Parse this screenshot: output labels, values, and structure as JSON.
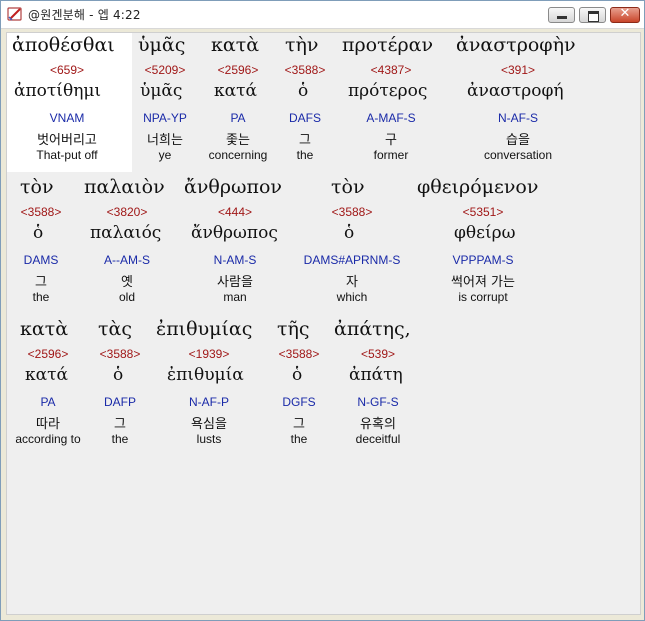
{
  "window": {
    "title": "@원겐분해 - 엡 4:22",
    "app_icon": "app-icon",
    "buttons": [
      "minimize",
      "maximize",
      "close"
    ],
    "close_glyph": "✕"
  },
  "lines": [
    {
      "words": [
        {
          "greek": "ἀποθέσθαι",
          "strong": "<659>",
          "lemma": "ἀποτίθημι",
          "parse": "VNAM",
          "korean": "벗어버리고",
          "english": "That-put off"
        },
        {
          "greek": "ὑμᾶς",
          "strong": "<5209>",
          "lemma": "ὑμᾶς",
          "parse": "NPA-YP",
          "korean": "너희는",
          "english": "ye"
        },
        {
          "greek": "κατὰ",
          "strong": "<2596>",
          "lemma": "κατά",
          "parse": "PA",
          "korean": "좇는",
          "english": "concerning"
        },
        {
          "greek": "τὴν",
          "strong": "<3588>",
          "lemma": "ὁ",
          "parse": "DAFS",
          "korean": "그",
          "english": "the"
        },
        {
          "greek": "προτέραν",
          "strong": "<4387>",
          "lemma": "πρότερος",
          "parse": "A-MAF-S",
          "korean": "구",
          "english": "former"
        },
        {
          "greek": "ἀναστροφὴν",
          "strong": "<391>",
          "lemma": "ἀναστροφή",
          "parse": "N-AF-S",
          "korean": "습을",
          "english": "conversation"
        }
      ]
    },
    {
      "words": [
        {
          "greek": "τὸν",
          "strong": "<3588>",
          "lemma": "ὁ",
          "parse": "DAMS",
          "korean": "그",
          "english": "the"
        },
        {
          "greek": "παλαιὸν",
          "strong": "<3820>",
          "lemma": "παλαιός",
          "parse": "A--AM-S",
          "korean": "옛",
          "english": "old"
        },
        {
          "greek": "ἄνθρωπον",
          "strong": "<444>",
          "lemma": "ἄνθρωπος",
          "parse": "N-AM-S",
          "korean": "사람을",
          "english": "man"
        },
        {
          "greek": "τὸν",
          "strong": "<3588>",
          "lemma": "ὁ",
          "parse": "DAMS#APRNM-S",
          "korean": "자",
          "english": "which"
        },
        {
          "greek": "φθειρόμενον",
          "strong": "<5351>",
          "lemma": "φθείρω",
          "parse": "VPPPAM-S",
          "korean": "썩어져 가는",
          "english": "is corrupt"
        }
      ]
    },
    {
      "words": [
        {
          "greek": "κατὰ",
          "strong": "<2596>",
          "lemma": "κατά",
          "parse": "PA",
          "korean": "따라",
          "english": "according to"
        },
        {
          "greek": "τὰς",
          "strong": "<3588>",
          "lemma": "ὁ",
          "parse": "DAFP",
          "korean": "그",
          "english": "the"
        },
        {
          "greek": "ἐπιθυμίας",
          "strong": "<1939>",
          "lemma": "ἐπιθυμία",
          "parse": "N-AF-P",
          "korean": "욕심을",
          "english": "lusts"
        },
        {
          "greek": "τῆς",
          "strong": "<3588>",
          "lemma": "ὁ",
          "parse": "DGFS",
          "korean": "그",
          "english": "the"
        },
        {
          "greek": "ἀπάτης,",
          "strong": "<539>",
          "lemma": "ἀπάτη",
          "parse": "N-GF-S",
          "korean": "유혹의",
          "english": "deceitful"
        }
      ]
    }
  ],
  "colors": {
    "strong_number": "#a01818",
    "parse_code": "#1a2aa8",
    "text": "#111111",
    "background": "#efefef",
    "selected_word": "#ffffff"
  }
}
